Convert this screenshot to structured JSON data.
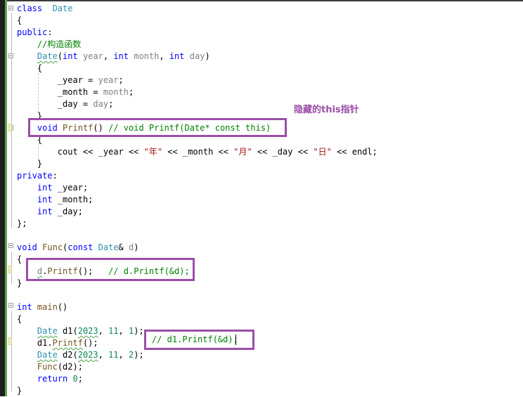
{
  "editor": {
    "lines": [
      {
        "n": 1,
        "segs": [
          [
            "kw",
            "class"
          ],
          [
            "",
            "  "
          ],
          [
            "ty",
            "Date"
          ]
        ]
      },
      {
        "n": 2,
        "segs": [
          [
            "",
            "{"
          ]
        ]
      },
      {
        "n": 3,
        "segs": [
          [
            "kw",
            "public"
          ],
          [
            "",
            ":"
          ]
        ]
      },
      {
        "n": 4,
        "segs": [
          [
            "",
            ""
          ],
          [
            "cm",
            "    //构造函数"
          ]
        ]
      },
      {
        "n": 5,
        "segs": [
          [
            "",
            "    "
          ],
          [
            "ty",
            "Date"
          ],
          [
            "",
            "("
          ],
          [
            "kw",
            "int"
          ],
          [
            "",
            " "
          ],
          [
            "pm",
            "year"
          ],
          [
            "",
            ", "
          ],
          [
            "kw",
            "int"
          ],
          [
            "",
            " "
          ],
          [
            "pm",
            "month"
          ],
          [
            "",
            ", "
          ],
          [
            "kw",
            "int"
          ],
          [
            "",
            " "
          ],
          [
            "pm",
            "day"
          ],
          [
            "",
            ")"
          ]
        ]
      },
      {
        "n": 6,
        "segs": [
          [
            "",
            "    {"
          ]
        ]
      },
      {
        "n": 7,
        "segs": [
          [
            "",
            "        _year = "
          ],
          [
            "pm",
            "year"
          ],
          [
            "",
            ";"
          ]
        ]
      },
      {
        "n": 8,
        "segs": [
          [
            "",
            "        _month = "
          ],
          [
            "pm",
            "month"
          ],
          [
            "",
            ";"
          ]
        ]
      },
      {
        "n": 9,
        "segs": [
          [
            "",
            "        _day = "
          ],
          [
            "pm",
            "day"
          ],
          [
            "",
            ";"
          ]
        ]
      },
      {
        "n": 10,
        "segs": [
          [
            "",
            "    }"
          ]
        ]
      },
      {
        "n": 11,
        "segs": [
          [
            "",
            "    "
          ],
          [
            "kw",
            "void"
          ],
          [
            "",
            " "
          ],
          [
            "fn",
            "Printf"
          ],
          [
            "",
            "() "
          ],
          [
            "cm",
            "// void Printf(Date* const this)"
          ]
        ]
      },
      {
        "n": 12,
        "segs": [
          [
            "",
            "    {"
          ]
        ]
      },
      {
        "n": 13,
        "segs": [
          [
            "",
            "        cout << _year << "
          ],
          [
            "str",
            "\"年\""
          ],
          [
            "",
            " << _month << "
          ],
          [
            "str",
            "\"月\""
          ],
          [
            "",
            " << _day << "
          ],
          [
            "str",
            "\"日\""
          ],
          [
            "",
            " << endl;"
          ]
        ]
      },
      {
        "n": 14,
        "segs": [
          [
            "",
            "    }"
          ]
        ]
      },
      {
        "n": 15,
        "segs": [
          [
            "kw",
            "private"
          ],
          [
            "",
            ":"
          ]
        ]
      },
      {
        "n": 16,
        "segs": [
          [
            "",
            "    "
          ],
          [
            "kw",
            "int"
          ],
          [
            "",
            " _year;"
          ]
        ]
      },
      {
        "n": 17,
        "segs": [
          [
            "",
            "    "
          ],
          [
            "kw",
            "int"
          ],
          [
            "",
            " _month;"
          ]
        ]
      },
      {
        "n": 18,
        "segs": [
          [
            "",
            "    "
          ],
          [
            "kw",
            "int"
          ],
          [
            "",
            " _day;"
          ]
        ]
      },
      {
        "n": 19,
        "segs": [
          [
            "",
            "};"
          ]
        ]
      },
      {
        "n": 20,
        "segs": [
          [
            "",
            ""
          ]
        ]
      },
      {
        "n": 21,
        "segs": [
          [
            "kw",
            "void"
          ],
          [
            "",
            " "
          ],
          [
            "fn",
            "Func"
          ],
          [
            "",
            "("
          ],
          [
            "kw",
            "const"
          ],
          [
            "",
            " "
          ],
          [
            "ty",
            "Date"
          ],
          [
            "",
            "& "
          ],
          [
            "pm",
            "d"
          ],
          [
            "",
            ")"
          ]
        ]
      },
      {
        "n": 22,
        "segs": [
          [
            "",
            "{"
          ]
        ]
      },
      {
        "n": 23,
        "segs": [
          [
            "",
            "    "
          ],
          [
            "pm",
            "d"
          ],
          [
            "",
            "."
          ],
          [
            "fn",
            "Printf"
          ],
          [
            "",
            "();   "
          ],
          [
            "cm",
            "// d.Printf(&d);"
          ]
        ]
      },
      {
        "n": 24,
        "segs": [
          [
            "",
            "}"
          ]
        ]
      },
      {
        "n": 25,
        "segs": [
          [
            "",
            ""
          ]
        ]
      },
      {
        "n": 26,
        "segs": [
          [
            "kw",
            "int"
          ],
          [
            "",
            " "
          ],
          [
            "fn",
            "main"
          ],
          [
            "",
            "()"
          ]
        ]
      },
      {
        "n": 27,
        "segs": [
          [
            "",
            "{"
          ]
        ]
      },
      {
        "n": 28,
        "segs": [
          [
            "",
            "    "
          ],
          [
            "ty",
            "Date"
          ],
          [
            "",
            " d1("
          ],
          [
            "num",
            "2023"
          ],
          [
            "",
            ", "
          ],
          [
            "num",
            "11"
          ],
          [
            "",
            ", "
          ],
          [
            "num",
            "1"
          ],
          [
            "",
            ");"
          ]
        ]
      },
      {
        "n": 29,
        "segs": [
          [
            "",
            "    d1."
          ],
          [
            "fn",
            "Printf"
          ],
          [
            "",
            "();"
          ]
        ]
      },
      {
        "n": 30,
        "segs": [
          [
            "",
            "    "
          ],
          [
            "ty",
            "Date"
          ],
          [
            "",
            " d2("
          ],
          [
            "num",
            "2023"
          ],
          [
            "",
            ", "
          ],
          [
            "num",
            "11"
          ],
          [
            "",
            ", "
          ],
          [
            "num",
            "2"
          ],
          [
            "",
            ");"
          ]
        ]
      },
      {
        "n": 31,
        "segs": [
          [
            "",
            "    "
          ],
          [
            "fn",
            "Func"
          ],
          [
            "",
            "(d2);"
          ]
        ]
      },
      {
        "n": 32,
        "segs": [
          [
            "",
            "    "
          ],
          [
            "kw",
            "return"
          ],
          [
            "",
            " "
          ],
          [
            "num",
            "0"
          ],
          [
            "",
            ";"
          ]
        ]
      },
      {
        "n": 33,
        "segs": [
          [
            "",
            "}"
          ]
        ]
      }
    ]
  },
  "annotations": {
    "hidden_this_label": "隐藏的this指针",
    "main_comment": "// d1.Printf(&d);"
  },
  "colors": {
    "keyword": "#0000ff",
    "type": "#2b91af",
    "function": "#74531f",
    "comment": "#008000",
    "string": "#a31515",
    "number": "#098658",
    "param": "#808080",
    "annotation": "#9b4ea8"
  }
}
